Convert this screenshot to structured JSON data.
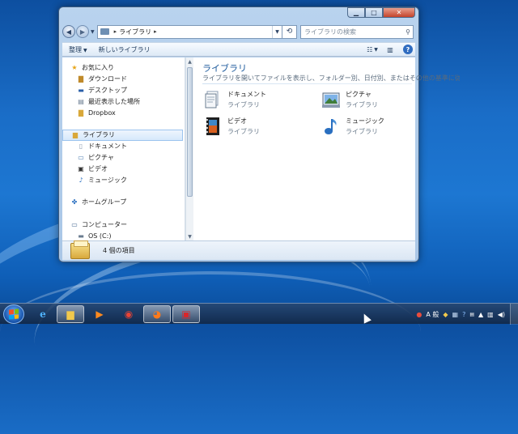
{
  "window": {
    "address": {
      "crumb": "ライブラリ"
    },
    "search": {
      "placeholder": "ライブラリの検索"
    },
    "commands": {
      "organize": "整理",
      "new_library": "新しいライブラリ"
    }
  },
  "nav": {
    "favorites": {
      "label": "お気に入り",
      "items": [
        "ダウンロード",
        "デスクトップ",
        "最近表示した場所",
        "Dropbox"
      ]
    },
    "libraries": {
      "label": "ライブラリ",
      "items": [
        "ドキュメント",
        "ピクチャ",
        "ビデオ",
        "ミュージック"
      ]
    },
    "homegroup": {
      "label": "ホームグループ"
    },
    "computer": {
      "label": "コンピューター",
      "items": [
        "OS (C:)"
      ]
    }
  },
  "main": {
    "title": "ライブラリ",
    "description": "ライブラリを開いてファイルを表示し、フォルダー別、日付別、またはその他の基準に従って整列し",
    "items": [
      {
        "name": "ドキュメント",
        "type": "ライブラリ",
        "icon": "documents-icon"
      },
      {
        "name": "ピクチャ",
        "type": "ライブラリ",
        "icon": "pictures-icon"
      },
      {
        "name": "ビデオ",
        "type": "ライブラリ",
        "icon": "videos-icon"
      },
      {
        "name": "ミュージック",
        "type": "ライブラリ",
        "icon": "music-icon"
      }
    ]
  },
  "details": {
    "count": "4 個の項目"
  },
  "taskbar": {
    "apps": [
      "internet-explorer-icon",
      "explorer-icon",
      "media-player-icon",
      "chrome-icon",
      "firefox-icon",
      "app-icon"
    ],
    "ime": "A 般"
  },
  "colors": {
    "accent": "#1c5a9c",
    "desktop": "#1a6dc7",
    "selection": "#d6e8fb"
  }
}
